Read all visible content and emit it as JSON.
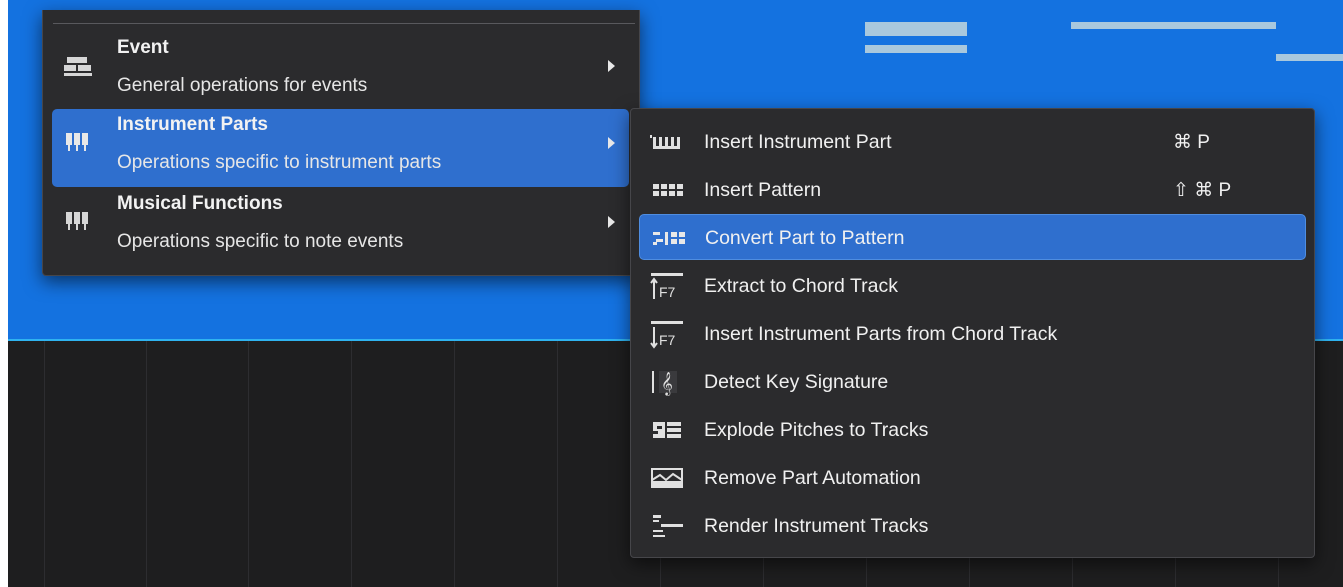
{
  "colors": {
    "track_lane": "#1472e0",
    "menu_bg": "#2b2b2d",
    "selection": "#2f6fce",
    "arrange_bg": "#1e1e1f",
    "note": "#a9c8dd"
  },
  "main_menu": {
    "items": [
      {
        "title": "Event",
        "description": "General operations for events",
        "icon": "event-blocks-icon",
        "selected": false
      },
      {
        "title": "Instrument Parts",
        "description": "Operations specific to instrument parts",
        "icon": "piano-keys-icon",
        "selected": true
      },
      {
        "title": "Musical Functions",
        "description": "Operations specific to note events",
        "icon": "piano-keys-icon",
        "selected": false
      }
    ]
  },
  "submenu": {
    "items": [
      {
        "label": "Insert Instrument Part",
        "shortcut": "⌘ P",
        "icon": "instrument-part-icon"
      },
      {
        "label": "Insert Pattern",
        "shortcut": "⇧ ⌘ P",
        "icon": "pattern-grid-icon"
      },
      {
        "label": "Convert Part to Pattern",
        "shortcut": "",
        "icon": "convert-pattern-icon",
        "selected": true
      },
      {
        "label": "Extract to Chord Track",
        "shortcut": "",
        "icon": "extract-chord-icon"
      },
      {
        "label": "Insert Instrument Parts from Chord Track",
        "shortcut": "",
        "icon": "insert-chord-icon"
      },
      {
        "label": "Detect Key Signature",
        "shortcut": "",
        "icon": "treble-clef-icon"
      },
      {
        "label": "Explode Pitches to Tracks",
        "shortcut": "",
        "icon": "explode-pitches-icon"
      },
      {
        "label": "Remove Part Automation",
        "shortcut": "",
        "icon": "automation-icon"
      },
      {
        "label": "Render Instrument Tracks",
        "shortcut": "",
        "icon": "render-tracks-icon"
      }
    ]
  }
}
